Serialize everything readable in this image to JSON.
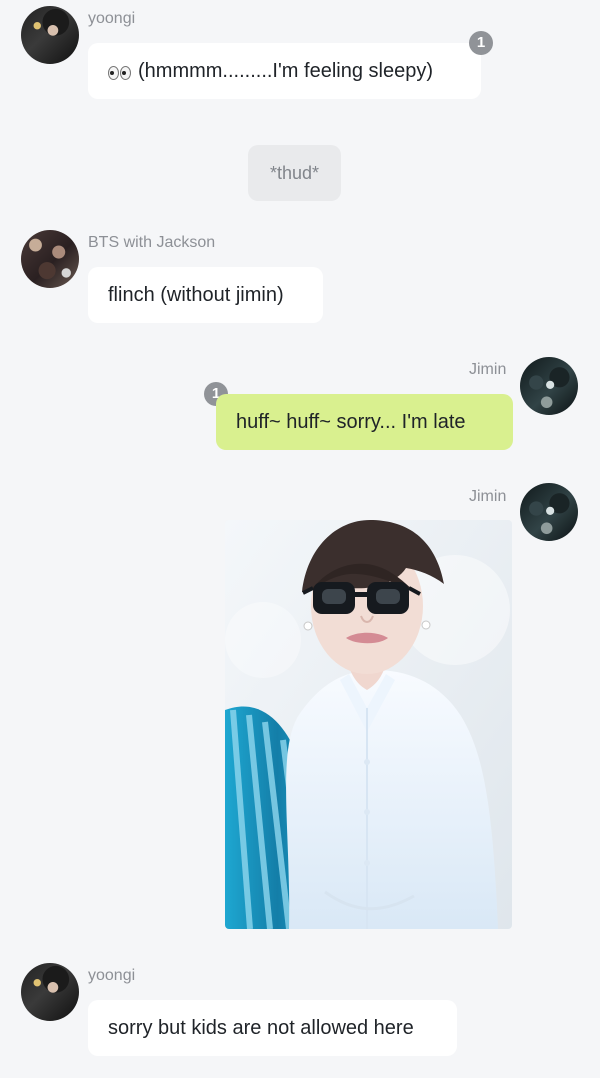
{
  "messages": [
    {
      "sender": "yoongi",
      "text": "(hmmmm.........I'm feeling sleepy)",
      "emoji": "eyes-emoji",
      "unread_badge": "1"
    },
    {
      "system_text": "*thud*"
    },
    {
      "sender": "BTS with Jackson",
      "text": "flinch (without jimin)"
    },
    {
      "sender": "Jimin",
      "text": "huff~ huff~ sorry... I'm late",
      "unread_badge": "1"
    },
    {
      "sender": "Jimin",
      "type": "image"
    },
    {
      "sender": "yoongi",
      "text": "sorry but kids are not allowed here"
    }
  ],
  "colors": {
    "background": "#f5f6f8",
    "incoming_bubble": "#ffffff",
    "outgoing_bubble": "#d9f08f",
    "system_bubble": "#e9eaec",
    "name_text": "#8d9096",
    "badge": "#909398"
  }
}
